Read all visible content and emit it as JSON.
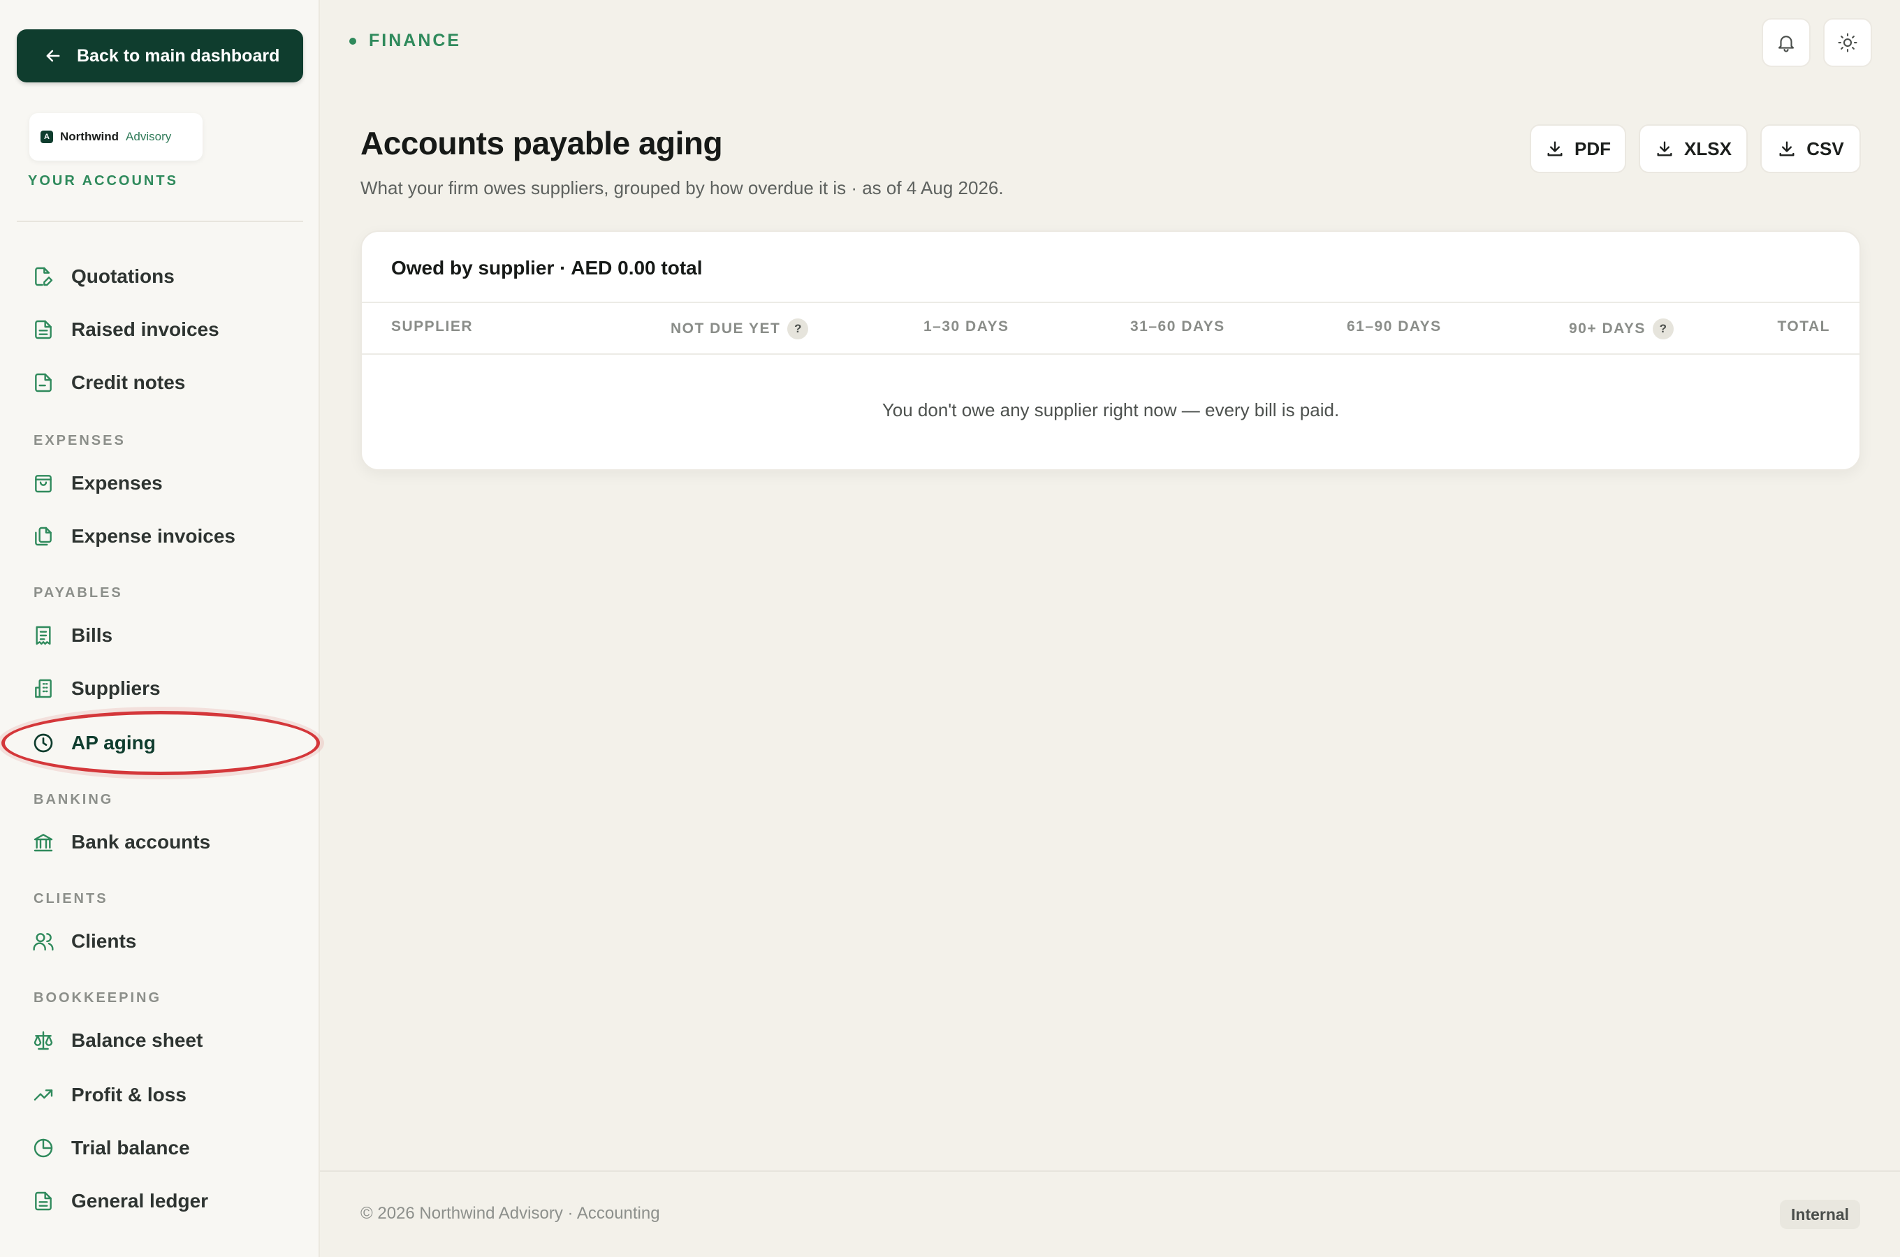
{
  "sidebar": {
    "back_label": "Back to main dashboard",
    "brand": {
      "name": "Northwind",
      "sub": "Advisory",
      "mark": "A"
    },
    "your_accounts": "YOUR ACCOUNTS",
    "items": {
      "quotations": "Quotations",
      "raised_invoices": "Raised invoices",
      "credit_notes": "Credit notes",
      "expenses": "Expenses",
      "expense_invoices": "Expense invoices",
      "bills": "Bills",
      "suppliers": "Suppliers",
      "ap_aging": "AP aging",
      "bank_accounts": "Bank accounts",
      "clients": "Clients",
      "balance_sheet": "Balance sheet",
      "profit_loss": "Profit & loss",
      "trial_balance": "Trial balance",
      "general_ledger": "General ledger"
    },
    "sections": {
      "expenses": "EXPENSES",
      "payables": "PAYABLES",
      "banking": "BANKING",
      "clients": "CLIENTS",
      "bookkeeping": "BOOKKEEPING"
    },
    "active_item": "AP aging"
  },
  "header": {
    "crumb": "FINANCE",
    "title": "Accounts payable aging",
    "subtitle": "What your firm owes suppliers, grouped by how overdue it is · as of 4 Aug 2026.",
    "exports": {
      "pdf": "PDF",
      "xlsx": "XLSX",
      "csv": "CSV"
    }
  },
  "table": {
    "title": "Owed by supplier · AED 0.00 total",
    "columns": {
      "supplier": "SUPPLIER",
      "not_due": "NOT DUE YET",
      "d1_30": "1–30 DAYS",
      "d31_60": "31–60 DAYS",
      "d61_90": "61–90 DAYS",
      "d90_plus": "90+ DAYS",
      "total": "TOTAL"
    },
    "help_mark": "?",
    "empty_message": "You don't owe any supplier right now — every bill is paid."
  },
  "footer": {
    "copyright": "© 2026 Northwind Advisory · Accounting",
    "badge": "Internal"
  },
  "colors": {
    "brand_dark": "#0f3d2e",
    "accent_green": "#2f8a5c",
    "highlight": "#d4373a"
  }
}
